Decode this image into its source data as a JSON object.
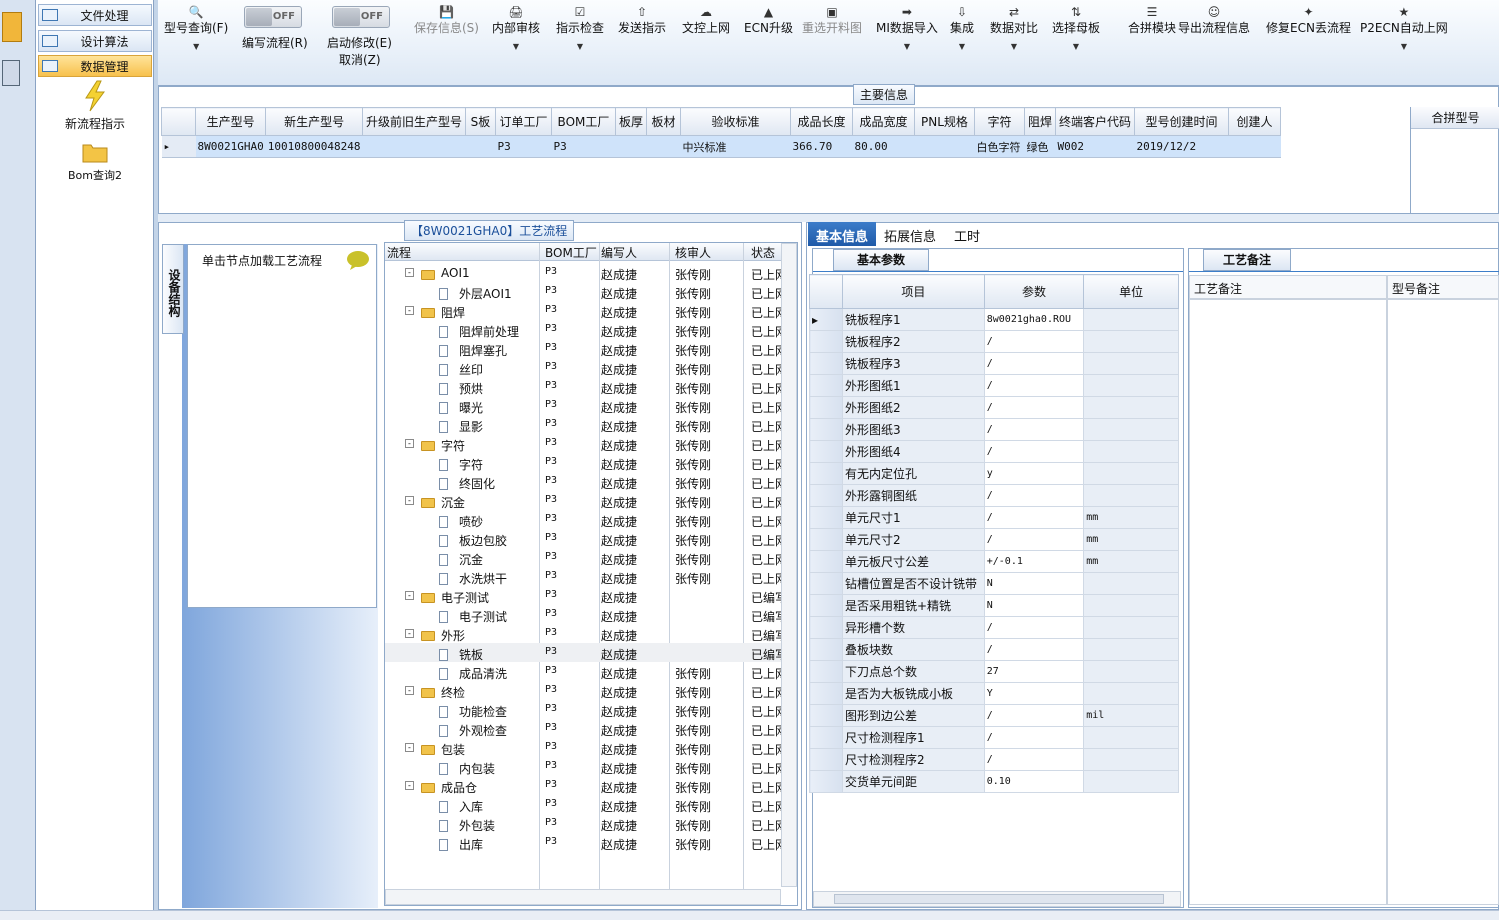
{
  "nav": {
    "items": [
      {
        "label": "文件处理",
        "active": false
      },
      {
        "label": "设计算法",
        "active": false
      },
      {
        "label": "数据管理",
        "active": true
      }
    ],
    "tiles": [
      {
        "label": "新流程指示",
        "icon": "lightning-icon"
      },
      {
        "label": "Bom查询2",
        "icon": "folder-icon"
      }
    ]
  },
  "toolbar": {
    "query": "型号查询(F)",
    "toggle1": {
      "state": "OFF",
      "label": "编写流程(R)"
    },
    "toggle2": {
      "state": "OFF",
      "label": "启动修改(E)",
      "sub": "取消(Z)"
    },
    "buttons": [
      {
        "label": "保存信息(S)",
        "disabled": true,
        "icon": "save-icon",
        "dropdown": false
      },
      {
        "label": "内部审核",
        "disabled": false,
        "icon": "print-icon",
        "dropdown": true
      },
      {
        "label": "指示检查",
        "disabled": false,
        "icon": "checkbox-icon",
        "dropdown": true
      },
      {
        "label": "发送指示",
        "disabled": false,
        "icon": "upload-icon",
        "dropdown": false
      },
      {
        "label": "文控上网",
        "disabled": false,
        "icon": "cloud-upload-icon",
        "dropdown": false
      },
      {
        "label": "ECN升级",
        "disabled": false,
        "icon": "ecn-icon",
        "dropdown": false
      },
      {
        "label": "重选开料图",
        "disabled": true,
        "icon": "image-icon",
        "dropdown": false
      },
      {
        "label": "MI数据导入",
        "disabled": false,
        "icon": "import-icon",
        "dropdown": true
      },
      {
        "label": "集成",
        "disabled": false,
        "icon": "download-icon",
        "dropdown": true
      },
      {
        "label": "数据对比",
        "disabled": false,
        "icon": "compare-icon",
        "dropdown": true
      },
      {
        "label": "选择母板",
        "disabled": false,
        "icon": "shuffle-icon",
        "dropdown": true
      },
      {
        "label": "合拼模块",
        "disabled": false,
        "icon": "list-icon",
        "dropdown": false
      },
      {
        "label": "导出流程信息",
        "disabled": false,
        "icon": "smiley-icon",
        "dropdown": false
      },
      {
        "label": "修复ECN丢流程",
        "disabled": false,
        "icon": "wrench-icon",
        "dropdown": false
      },
      {
        "label": "P2ECN自动上网",
        "disabled": false,
        "icon": "star-icon",
        "dropdown": true
      }
    ]
  },
  "main_info": {
    "group_label": "主要信息",
    "columns": [
      "生产型号",
      "新生产型号",
      "升级前旧生产型号",
      "S板",
      "订单工厂",
      "BOM工厂",
      "板厚",
      "板材",
      "验收标准",
      "成品长度",
      "成品宽度",
      "PNL规格",
      "字符",
      "阻焊",
      "终端客户代码",
      "型号创建时间",
      "创建人"
    ],
    "row": [
      "8W0021GHA0",
      "10010800048248",
      "",
      "",
      "P3",
      "P3",
      "",
      "",
      "中兴标准",
      "366.70",
      "80.00",
      "",
      "白色字符",
      "绿色",
      "W002",
      "2019/12/2",
      ""
    ],
    "merge_label": "合拼型号"
  },
  "flow": {
    "title": "【8W0021GHA0】工艺流程",
    "vtab": "设备结构",
    "click_hint": "单击节点加载工艺流程",
    "columns": [
      "流程",
      "BOM工厂",
      "编写人",
      "核审人",
      "状态"
    ],
    "rows": [
      {
        "level": 0,
        "name": "AOI1",
        "bom": "P3",
        "writer": "赵成捷",
        "reviewer": "张传刚",
        "status": "已上网"
      },
      {
        "level": 1,
        "name": "外层AOI1",
        "bom": "P3",
        "writer": "赵成捷",
        "reviewer": "张传刚",
        "status": "已上网"
      },
      {
        "level": 0,
        "name": "阻焊",
        "bom": "P3",
        "writer": "赵成捷",
        "reviewer": "张传刚",
        "status": "已上网"
      },
      {
        "level": 1,
        "name": "阻焊前处理",
        "bom": "P3",
        "writer": "赵成捷",
        "reviewer": "张传刚",
        "status": "已上网"
      },
      {
        "level": 1,
        "name": "阻焊塞孔",
        "bom": "P3",
        "writer": "赵成捷",
        "reviewer": "张传刚",
        "status": "已上网"
      },
      {
        "level": 1,
        "name": "丝印",
        "bom": "P3",
        "writer": "赵成捷",
        "reviewer": "张传刚",
        "status": "已上网"
      },
      {
        "level": 1,
        "name": "预烘",
        "bom": "P3",
        "writer": "赵成捷",
        "reviewer": "张传刚",
        "status": "已上网"
      },
      {
        "level": 1,
        "name": "曝光",
        "bom": "P3",
        "writer": "赵成捷",
        "reviewer": "张传刚",
        "status": "已上网"
      },
      {
        "level": 1,
        "name": "显影",
        "bom": "P3",
        "writer": "赵成捷",
        "reviewer": "张传刚",
        "status": "已上网"
      },
      {
        "level": 0,
        "name": "字符",
        "bom": "P3",
        "writer": "赵成捷",
        "reviewer": "张传刚",
        "status": "已上网"
      },
      {
        "level": 1,
        "name": "字符",
        "bom": "P3",
        "writer": "赵成捷",
        "reviewer": "张传刚",
        "status": "已上网"
      },
      {
        "level": 1,
        "name": "终固化",
        "bom": "P3",
        "writer": "赵成捷",
        "reviewer": "张传刚",
        "status": "已上网"
      },
      {
        "level": 0,
        "name": "沉金",
        "bom": "P3",
        "writer": "赵成捷",
        "reviewer": "张传刚",
        "status": "已上网"
      },
      {
        "level": 1,
        "name": "喷砂",
        "bom": "P3",
        "writer": "赵成捷",
        "reviewer": "张传刚",
        "status": "已上网"
      },
      {
        "level": 1,
        "name": "板边包胶",
        "bom": "P3",
        "writer": "赵成捷",
        "reviewer": "张传刚",
        "status": "已上网"
      },
      {
        "level": 1,
        "name": "沉金",
        "bom": "P3",
        "writer": "赵成捷",
        "reviewer": "张传刚",
        "status": "已上网"
      },
      {
        "level": 1,
        "name": "水洗烘干",
        "bom": "P3",
        "writer": "赵成捷",
        "reviewer": "张传刚",
        "status": "已上网"
      },
      {
        "level": 0,
        "name": "电子测试",
        "bom": "P3",
        "writer": "赵成捷",
        "reviewer": "",
        "status": "已编写"
      },
      {
        "level": 1,
        "name": "电子测试",
        "bom": "P3",
        "writer": "赵成捷",
        "reviewer": "",
        "status": "已编写"
      },
      {
        "level": 0,
        "name": "外形",
        "bom": "P3",
        "writer": "赵成捷",
        "reviewer": "",
        "status": "已编写"
      },
      {
        "level": 1,
        "name": "铣板",
        "bom": "P3",
        "writer": "赵成捷",
        "reviewer": "",
        "status": "已编写"
      },
      {
        "level": 1,
        "name": "成品清洗",
        "bom": "P3",
        "writer": "赵成捷",
        "reviewer": "张传刚",
        "status": "已上网"
      },
      {
        "level": 0,
        "name": "终检",
        "bom": "P3",
        "writer": "赵成捷",
        "reviewer": "张传刚",
        "status": "已上网"
      },
      {
        "level": 1,
        "name": "功能检查",
        "bom": "P3",
        "writer": "赵成捷",
        "reviewer": "张传刚",
        "status": "已上网"
      },
      {
        "level": 1,
        "name": "外观检查",
        "bom": "P3",
        "writer": "赵成捷",
        "reviewer": "张传刚",
        "status": "已上网"
      },
      {
        "level": 0,
        "name": "包装",
        "bom": "P3",
        "writer": "赵成捷",
        "reviewer": "张传刚",
        "status": "已上网"
      },
      {
        "level": 1,
        "name": "内包装",
        "bom": "P3",
        "writer": "赵成捷",
        "reviewer": "张传刚",
        "status": "已上网"
      },
      {
        "level": 0,
        "name": "成品仓",
        "bom": "P3",
        "writer": "赵成捷",
        "reviewer": "张传刚",
        "status": "已上网"
      },
      {
        "level": 1,
        "name": "入库",
        "bom": "P3",
        "writer": "赵成捷",
        "reviewer": "张传刚",
        "status": "已上网"
      },
      {
        "level": 1,
        "name": "外包装",
        "bom": "P3",
        "writer": "赵成捷",
        "reviewer": "张传刚",
        "status": "已上网"
      },
      {
        "level": 1,
        "name": "出库",
        "bom": "P3",
        "writer": "赵成捷",
        "reviewer": "张传刚",
        "status": "已上网"
      }
    ]
  },
  "info": {
    "tabs": [
      "基本信息",
      "拓展信息",
      "工时"
    ],
    "subtab": "基本参数",
    "columns": [
      "项目",
      "参数",
      "单位"
    ],
    "params": [
      {
        "item": "铣板程序1",
        "value": "8w0021gha0.ROU",
        "unit": ""
      },
      {
        "item": "铣板程序2",
        "value": "/",
        "unit": ""
      },
      {
        "item": "铣板程序3",
        "value": "/",
        "unit": ""
      },
      {
        "item": "外形图纸1",
        "value": "/",
        "unit": ""
      },
      {
        "item": "外形图纸2",
        "value": "/",
        "unit": ""
      },
      {
        "item": "外形图纸3",
        "value": "/",
        "unit": ""
      },
      {
        "item": "外形图纸4",
        "value": "/",
        "unit": ""
      },
      {
        "item": "有无内定位孔",
        "value": "y",
        "unit": ""
      },
      {
        "item": "外形露铜图纸",
        "value": "/",
        "unit": ""
      },
      {
        "item": "单元尺寸1",
        "value": "/",
        "unit": "mm"
      },
      {
        "item": "单元尺寸2",
        "value": "/",
        "unit": "mm"
      },
      {
        "item": "单元板尺寸公差",
        "value": "+/-0.1",
        "unit": "mm"
      },
      {
        "item": "钻槽位置是否不设计铣带",
        "value": "N",
        "unit": ""
      },
      {
        "item": "是否采用粗铣+精铣",
        "value": "N",
        "unit": ""
      },
      {
        "item": "异形槽个数",
        "value": "/",
        "unit": ""
      },
      {
        "item": "叠板块数",
        "value": "/",
        "unit": ""
      },
      {
        "item": "下刀点总个数",
        "value": "27",
        "unit": ""
      },
      {
        "item": "是否为大板铣成小板",
        "value": "Y",
        "unit": ""
      },
      {
        "item": "图形到边公差",
        "value": "/",
        "unit": "mil"
      },
      {
        "item": "尺寸检测程序1",
        "value": "/",
        "unit": ""
      },
      {
        "item": "尺寸检测程序2",
        "value": "/",
        "unit": ""
      },
      {
        "item": "交货单元间距",
        "value": "0.10",
        "unit": ""
      }
    ],
    "remarks_tab": "工艺备注",
    "remarks_cols": [
      "工艺备注",
      "型号备注"
    ]
  }
}
